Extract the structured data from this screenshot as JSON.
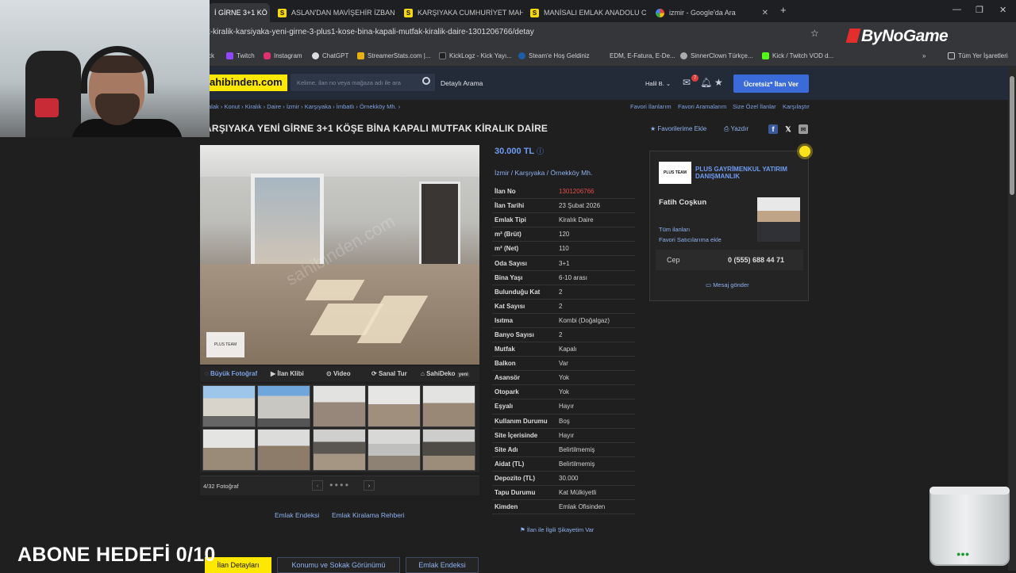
{
  "browser": {
    "tabs": [
      {
        "title": "İ GİRNE 3+1 KÖ",
        "active": true
      },
      {
        "title": "ASLAN'DAN MAVİŞEHİR İZBAN"
      },
      {
        "title": "KARŞIYAKA CUMHURİYET MAH"
      },
      {
        "title": "MANİSALI EMLAK ANADOLU C"
      },
      {
        "title": "izmir - Google'da Ara"
      }
    ],
    "new_tab": "+",
    "url": "t-kiralik-karsiyaka-yeni-girne-3-plus1-kose-bina-kapali-mutfak-kiralik-daire-1301206766/detay",
    "bookmarks": [
      "ck",
      "Twitch",
      "Instagram",
      "ChatGPT",
      "StreamerStats.com |...",
      "KickLogz - Kick Yayı...",
      "Steam'e Hoş Geldiniz",
      "EDM, E-Fatura, E-De...",
      "SinnerClown Türkçe...",
      "Kick / Twitch VOD d...",
      "Tüm Yer İşaretleri"
    ],
    "overflow": "»"
  },
  "overlay": {
    "brand": "ByNoGame",
    "abone": "ABONE HEDEFİ 0/10"
  },
  "header": {
    "logo": "ahibinden.com",
    "search_placeholder": "Kelime, ilan no veya mağaza adı ile ara",
    "detailed_search": "Detaylı Arama",
    "user": "Halil B.",
    "notif_count": "7",
    "cta": "Ücretsiz* İlan Ver"
  },
  "breadcrumb": [
    "alak",
    "Konut",
    "Kiralık",
    "Daire",
    "İzmir",
    "Karşıyaka",
    "İmbatlı",
    "Örnekköy Mh."
  ],
  "toplinks": [
    "Favori İlanlarım",
    "Favori Aramalarım",
    "Size Özel İlanlar",
    "Karşılaştır"
  ],
  "listing": {
    "title": "ARŞIYAKA YENİ GİRNE 3+1 KÖŞE BİNA KAPALI MUTFAK KİRALIK DAİRE",
    "fav_label": "Favorilerime Ekle",
    "print_label": "Yazdır",
    "price": "30.000 TL",
    "location": [
      "İzmir",
      "Karşıyaka",
      "Örnekköy Mh."
    ],
    "details": [
      {
        "k": "İlan No",
        "v": "1301206766"
      },
      {
        "k": "İlan Tarihi",
        "v": "23 Şubat 2026"
      },
      {
        "k": "Emlak Tipi",
        "v": "Kiralık Daire"
      },
      {
        "k": "m² (Brüt)",
        "v": "120"
      },
      {
        "k": "m² (Net)",
        "v": "110"
      },
      {
        "k": "Oda Sayısı",
        "v": "3+1"
      },
      {
        "k": "Bina Yaşı",
        "v": "6-10 arası"
      },
      {
        "k": "Bulunduğu Kat",
        "v": "2"
      },
      {
        "k": "Kat Sayısı",
        "v": "2"
      },
      {
        "k": "Isıtma",
        "v": "Kombi (Doğalgaz)"
      },
      {
        "k": "Banyo Sayısı",
        "v": "2"
      },
      {
        "k": "Mutfak",
        "v": "Kapalı"
      },
      {
        "k": "Balkon",
        "v": "Var"
      },
      {
        "k": "Asansör",
        "v": "Yok"
      },
      {
        "k": "Otopark",
        "v": "Yok"
      },
      {
        "k": "Eşyalı",
        "v": "Hayır"
      },
      {
        "k": "Kullanım Durumu",
        "v": "Boş"
      },
      {
        "k": "Site İçerisinde",
        "v": "Hayır"
      },
      {
        "k": "Site Adı",
        "v": "Belirtilmemiş"
      },
      {
        "k": "Aidat (TL)",
        "v": "Belirtilmemiş"
      },
      {
        "k": "Depozito (TL)",
        "v": "30.000"
      },
      {
        "k": "Tapu Durumu",
        "v": "Kat Mülkiyetli"
      },
      {
        "k": "Kimden",
        "v": "Emlak Ofisinden"
      }
    ],
    "complaint": "İlan ile İlgili Şikayetim Var"
  },
  "media": {
    "tabs": [
      "Büyük Fotoğraf",
      "İlan Klibi",
      "Video",
      "Sanal Tur",
      "SahiDeko"
    ],
    "new_badge": "yeni",
    "counter": "4/32 Fotoğraf",
    "watermark": "sahibinden.com",
    "logo_text": "PLUS TEAM",
    "prev": "‹",
    "next": "›"
  },
  "under_links": [
    "Emlak Endeksi",
    "Emlak Kiralama Rehberi"
  ],
  "seller": {
    "company": "PLUS GAYRİMENKUL YATIRIM DANIŞMANLIK",
    "logo_text": "PLUS TEAM",
    "agent": "Fatih Coşkun",
    "all_listings": "Tüm ilanları",
    "fav_seller": "Favori Satıcılarıma ekle",
    "phone_label": "Cep",
    "phone": "0 (555) 688 44 71",
    "message": "Mesaj gönder"
  },
  "bottom_tabs": [
    "İlan Detayları",
    "Konumu ve Sokak Görünümü",
    "Emlak Endeksi"
  ],
  "colors": {
    "brand_yellow": "#ffe800",
    "link": "#8fb1ef",
    "cta": "#3b6bd9",
    "ilan_no": "#e34b4b"
  }
}
